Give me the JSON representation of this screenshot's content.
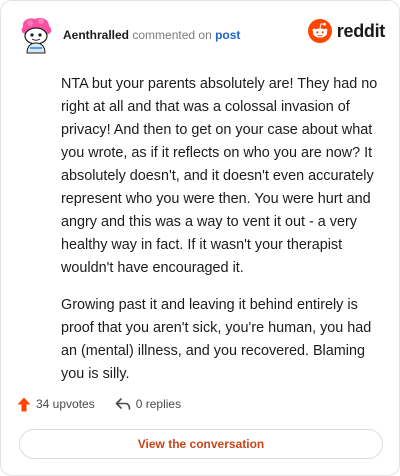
{
  "comment": {
    "author": "Aenthralled",
    "action": "commented on",
    "post_link": "post",
    "paragraphs": [
      "NTA but your parents absolutely are! They had no right at all and that was a colossal invasion of privacy! And then to get on your case about what you wrote, as if it reflects on who you are now? It absolutely doesn't, and it doesn't even accurately represent who you were then. You were hurt and angry and this was a way to vent it out - a very healthy way in fact. If it wasn't your therapist wouldn't have encouraged it.",
      "Growing past it and leaving it behind entirely is proof that you aren't sick, you're human, you had an (mental) illness, and you recovered. Blaming you is silly."
    ],
    "upvotes": "34 upvotes",
    "replies": "0 replies"
  },
  "brand": {
    "name": "reddit",
    "logo_icon": "reddit-snoo-icon",
    "accent_color": "#ff4500"
  },
  "cta": {
    "label": "View the conversation"
  }
}
